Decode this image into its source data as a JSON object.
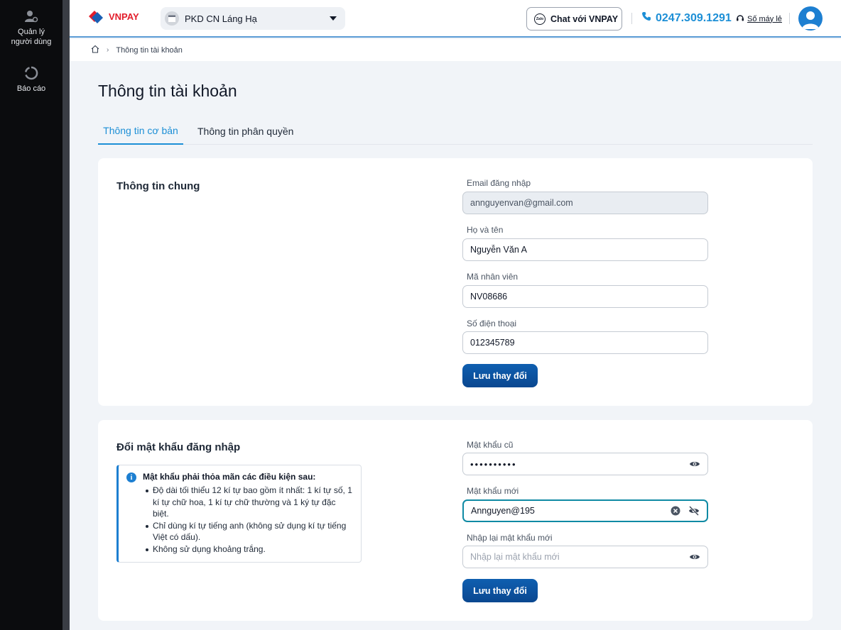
{
  "sidebar": {
    "items": [
      {
        "label": "Quản lý người dùng",
        "icon": "user-gear-icon"
      },
      {
        "label": "Báo cáo",
        "icon": "report-icon"
      }
    ]
  },
  "header": {
    "logo": "VNPAY",
    "branch": "PKD CN Láng Hạ",
    "chat_label": "Chat với VNPAY",
    "zalo_badge": "Zalo",
    "hotline": "0247.309.1291",
    "extension_label": "Số máy lẻ"
  },
  "breadcrumb": {
    "current": "Thông tin tài khoản"
  },
  "page": {
    "title": "Thông tin tài khoản"
  },
  "tabs": [
    {
      "label": "Thông tin cơ bản",
      "active": true
    },
    {
      "label": "Thông tin phân quyền",
      "active": false
    }
  ],
  "general": {
    "title": "Thông tin chung",
    "email": {
      "label": "Email đăng nhập",
      "value": "annguyenvan@gmail.com"
    },
    "name": {
      "label": "Họ và tên",
      "value": "Nguyễn Văn A"
    },
    "employee_id": {
      "label": "Mã nhân viên",
      "value": "NV08686"
    },
    "phone": {
      "label": "Số điện thoại",
      "value": "012345789"
    },
    "save_label": "Lưu thay đổi"
  },
  "password": {
    "title": "Đổi mật khẩu đăng nhập",
    "rules_title": "Mật khẩu phải thỏa mãn các điều kiện sau:",
    "rules": [
      "Độ dài tối thiểu 12 kí tự bao gồm ít nhất: 1 kí tự số, 1 kí tự chữ hoa, 1 kí tự chữ thường và 1 ký tự đặc biệt.",
      "Chỉ dùng kí tự tiếng anh (không sử dụng kí tự tiếng Việt có dấu).",
      "Không sử dụng khoảng trắng."
    ],
    "old": {
      "label": "Mật khẩu cũ",
      "value": "••••••••••"
    },
    "new": {
      "label": "Mật khẩu mới",
      "value": "Annguyen@195"
    },
    "confirm": {
      "label": "Nhập lại mật khẩu mới",
      "placeholder": "Nhập lại mật khẩu mới"
    },
    "save_label": "Lưu thay đổi"
  },
  "colors": {
    "accent": "#1d8fd6",
    "button": "#0a4f9e",
    "sidebar": "#0b0c0e"
  }
}
